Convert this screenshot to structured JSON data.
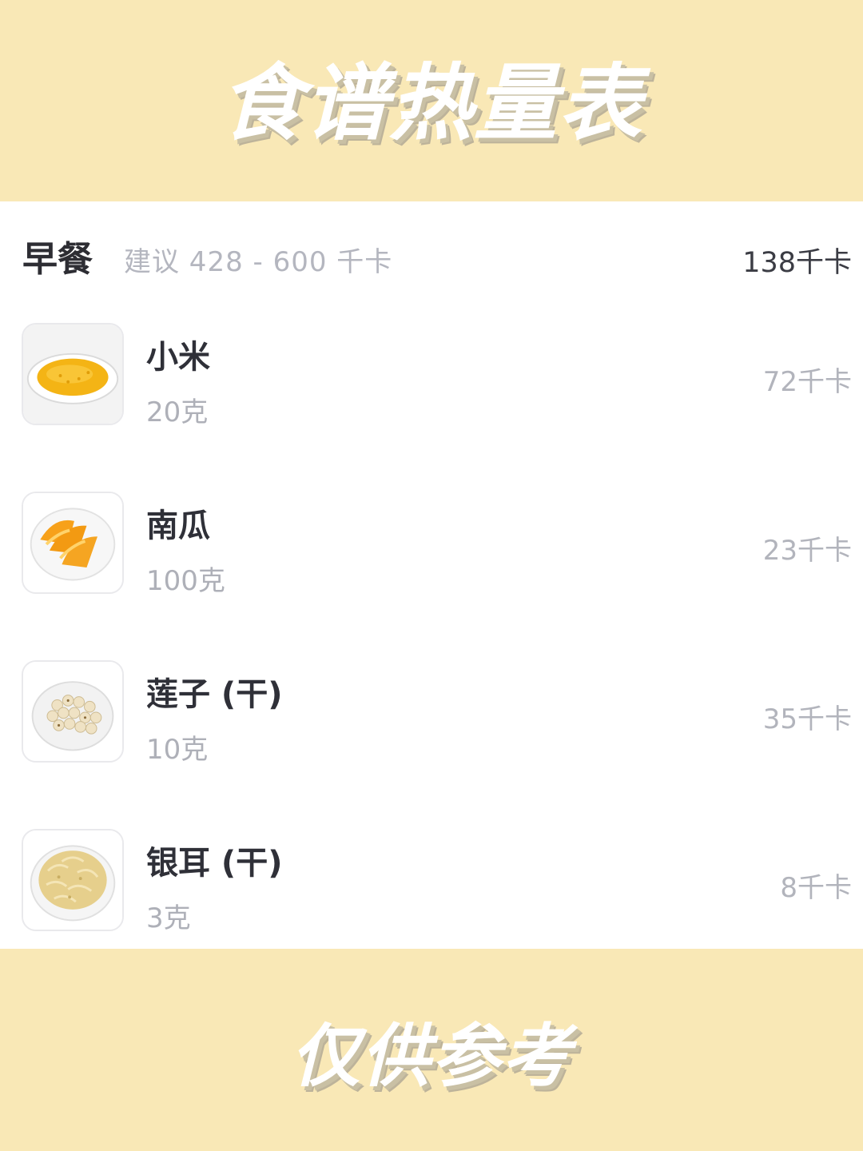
{
  "banners": {
    "top_title": "食谱热量表",
    "bottom_title": "仅供参考"
  },
  "meal": {
    "name": "早餐",
    "suggestion": "建议 428 - 600 千卡",
    "total": "138千卡"
  },
  "foods": [
    {
      "name": "小米",
      "amount": "20克",
      "kcal": "72千卡",
      "icon": "millet-plate-icon"
    },
    {
      "name": "南瓜",
      "amount": "100克",
      "kcal": "23千卡",
      "icon": "pumpkin-plate-icon"
    },
    {
      "name": "莲子 (干)",
      "amount": "10克",
      "kcal": "35千卡",
      "icon": "lotus-seed-bowl-icon"
    },
    {
      "name": "银耳 (干)",
      "amount": "3克",
      "kcal": "8千卡",
      "icon": "white-fungus-plate-icon"
    }
  ]
}
